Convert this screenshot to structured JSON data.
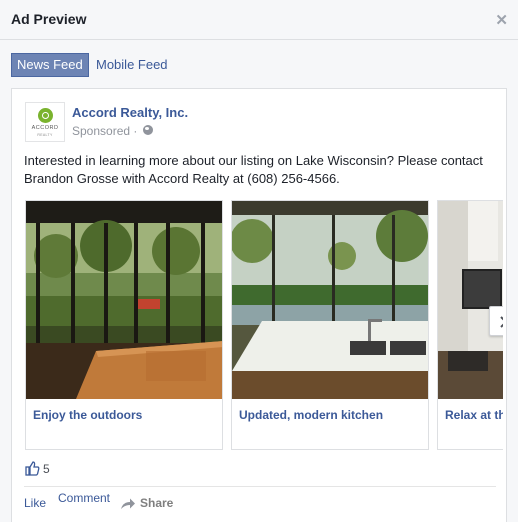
{
  "dialog": {
    "title": "Ad Preview",
    "close_icon": "close-icon"
  },
  "tabs": [
    {
      "label": "News Feed",
      "active": true
    },
    {
      "label": "Mobile Feed",
      "active": false
    }
  ],
  "post": {
    "page_name": "Accord Realty, Inc.",
    "logo_text": "ACCORD",
    "logo_subtext": "REALTY",
    "sponsored": "Sponsored ·",
    "text": "Interested in learning more about our listing on Lake Wisconsin? Please contact Brandon Grosse with Accord Realty at (608) 256-4566.",
    "carousel": [
      {
        "caption": "Enjoy the outdoors",
        "image": "screened-porch-photo"
      },
      {
        "caption": "Updated, modern kitchen",
        "image": "kitchen-photo"
      },
      {
        "caption": "Relax at the",
        "image": "living-room-photo"
      }
    ],
    "like_count": "5",
    "actions": {
      "like": "Like",
      "comment": "Comment",
      "share": "Share"
    }
  },
  "colors": {
    "brand_blue": "#3b5998",
    "active_tab": "#6d84b4",
    "logo_green": "#7ab32e"
  }
}
